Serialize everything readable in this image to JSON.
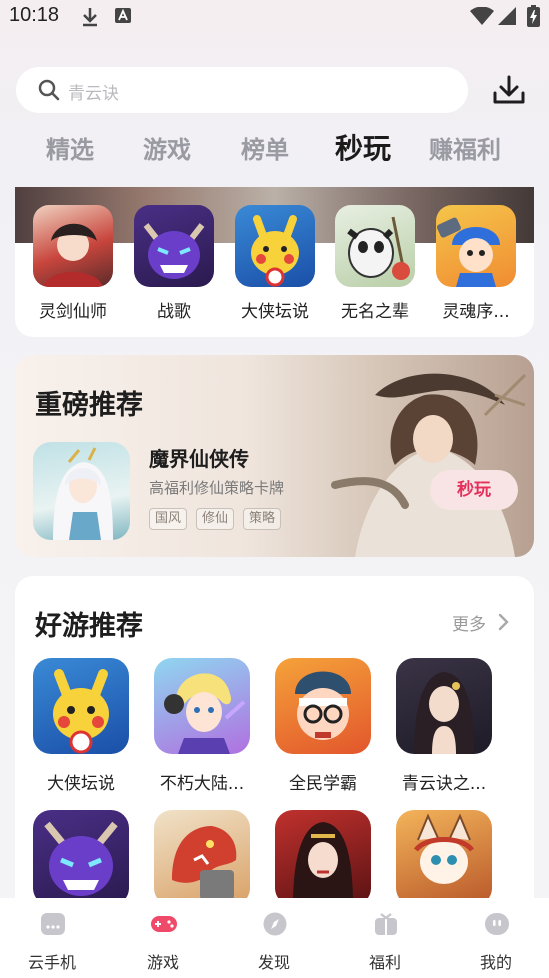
{
  "status_bar": {
    "time": "10:18"
  },
  "search": {
    "placeholder": "青云诀"
  },
  "tabs": [
    {
      "label": "精选",
      "active": false
    },
    {
      "label": "游戏",
      "active": false
    },
    {
      "label": "榜单",
      "active": false
    },
    {
      "label": "秒玩",
      "active": true
    },
    {
      "label": "赚福利",
      "active": false
    }
  ],
  "quick_games": [
    {
      "name": "灵剑仙师"
    },
    {
      "name": "战歌"
    },
    {
      "name": "大侠坛说"
    },
    {
      "name": "无名之辈"
    },
    {
      "name": "灵魂序..."
    }
  ],
  "featured": {
    "section_title": "重磅推荐",
    "game_name": "魔界仙侠传",
    "description": "高福利修仙策略卡牌",
    "tags": [
      "国风",
      "修仙",
      "策略"
    ],
    "play_button": "秒玩"
  },
  "recommend": {
    "section_title": "好游推荐",
    "more_label": "更多",
    "games_row1": [
      {
        "name": "大侠坛说"
      },
      {
        "name": "不朽大陆..."
      },
      {
        "name": "全民学霸"
      },
      {
        "name": "青云诀之..."
      }
    ]
  },
  "bottom_nav": [
    {
      "label": "云手机",
      "icon": "cloud-phone-icon"
    },
    {
      "label": "游戏",
      "icon": "gamepad-icon",
      "active": true
    },
    {
      "label": "发现",
      "icon": "compass-icon"
    },
    {
      "label": "福利",
      "icon": "gift-icon"
    },
    {
      "label": "我的",
      "icon": "profile-icon"
    }
  ],
  "colors": {
    "accent": "#e6305c",
    "active_nav": "#f04a6a",
    "inactive_icon": "#c6c6cc"
  }
}
